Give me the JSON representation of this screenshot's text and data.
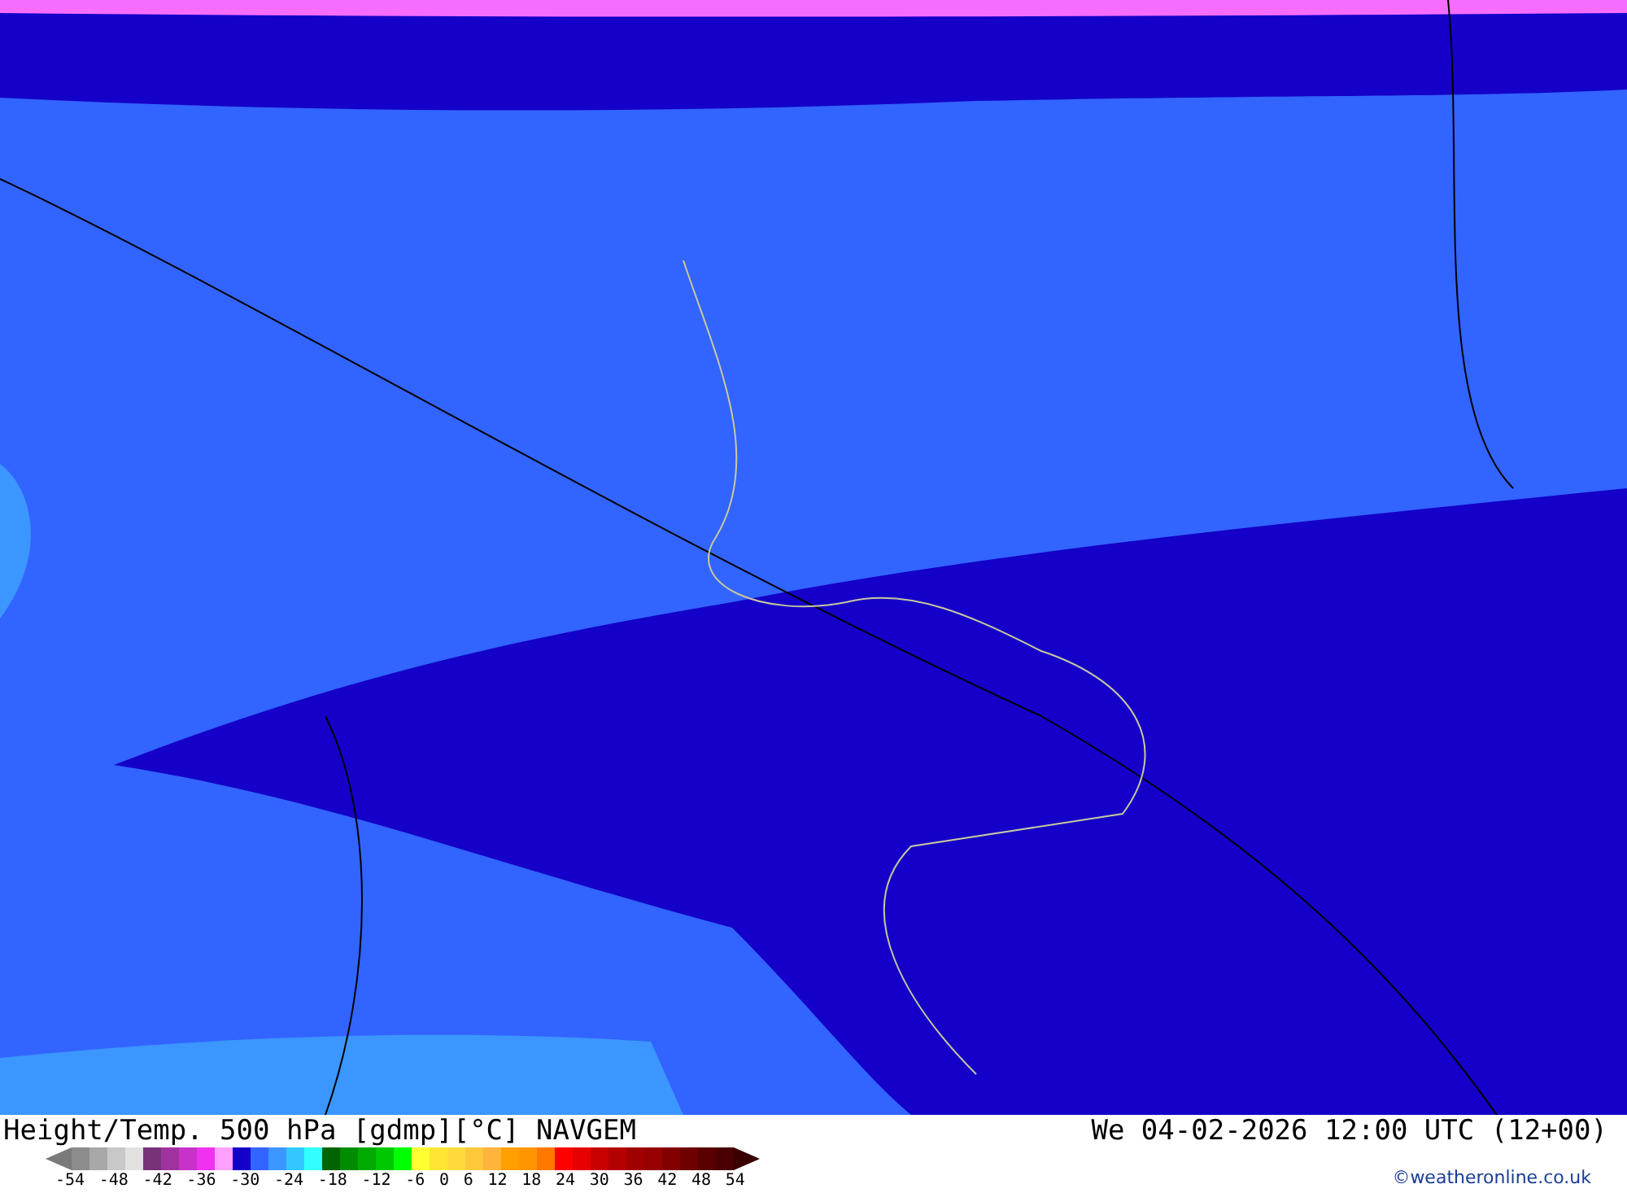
{
  "title": "Height/Temp. 500 hPa [gdmp][°C] NAVGEM",
  "valid_time": "We 04-02-2026 12:00 UTC (12+00)",
  "legend": {
    "swatches": [
      {
        "kind": "low",
        "color": "#7a7a7a"
      },
      {
        "color": "#8c8c8c"
      },
      {
        "color": "#a8a8a8"
      },
      {
        "color": "#c8c8c8"
      },
      {
        "color": "#e1e1e1"
      },
      {
        "color": "#783278"
      },
      {
        "color": "#a032a0"
      },
      {
        "color": "#c832c8"
      },
      {
        "color": "#f032f0"
      },
      {
        "color": "#ffa0ff"
      },
      {
        "color": "#1400c8"
      },
      {
        "color": "#3264ff"
      },
      {
        "color": "#3c96ff"
      },
      {
        "color": "#32c8ff"
      },
      {
        "color": "#32ffff"
      },
      {
        "color": "#006400"
      },
      {
        "color": "#008c00"
      },
      {
        "color": "#00aa00"
      },
      {
        "color": "#00c800"
      },
      {
        "color": "#00ff00"
      },
      {
        "color": "#ffff32"
      },
      {
        "color": "#ffe632"
      },
      {
        "color": "#ffdc3c"
      },
      {
        "color": "#ffc83c"
      },
      {
        "color": "#ffb43c"
      },
      {
        "color": "#ffa000"
      },
      {
        "color": "#ff9600"
      },
      {
        "color": "#ff7800"
      },
      {
        "color": "#ff0000"
      },
      {
        "color": "#e60000"
      },
      {
        "color": "#c80000"
      },
      {
        "color": "#b40000"
      },
      {
        "color": "#a00000"
      },
      {
        "color": "#960000"
      },
      {
        "color": "#820000"
      },
      {
        "color": "#6e0000"
      },
      {
        "color": "#5a0000"
      },
      {
        "color": "#4a0000"
      },
      {
        "kind": "high",
        "color": "#3a0000"
      }
    ],
    "ticks": [
      "-54",
      "-48",
      "-42",
      "-36",
      "-30",
      "-24",
      "-18",
      "-12",
      "-6",
      "0",
      "6",
      "12",
      "18",
      "24",
      "30",
      "36",
      "42",
      "48",
      "54"
    ]
  },
  "credit": "©weatheronline.co.uk"
}
